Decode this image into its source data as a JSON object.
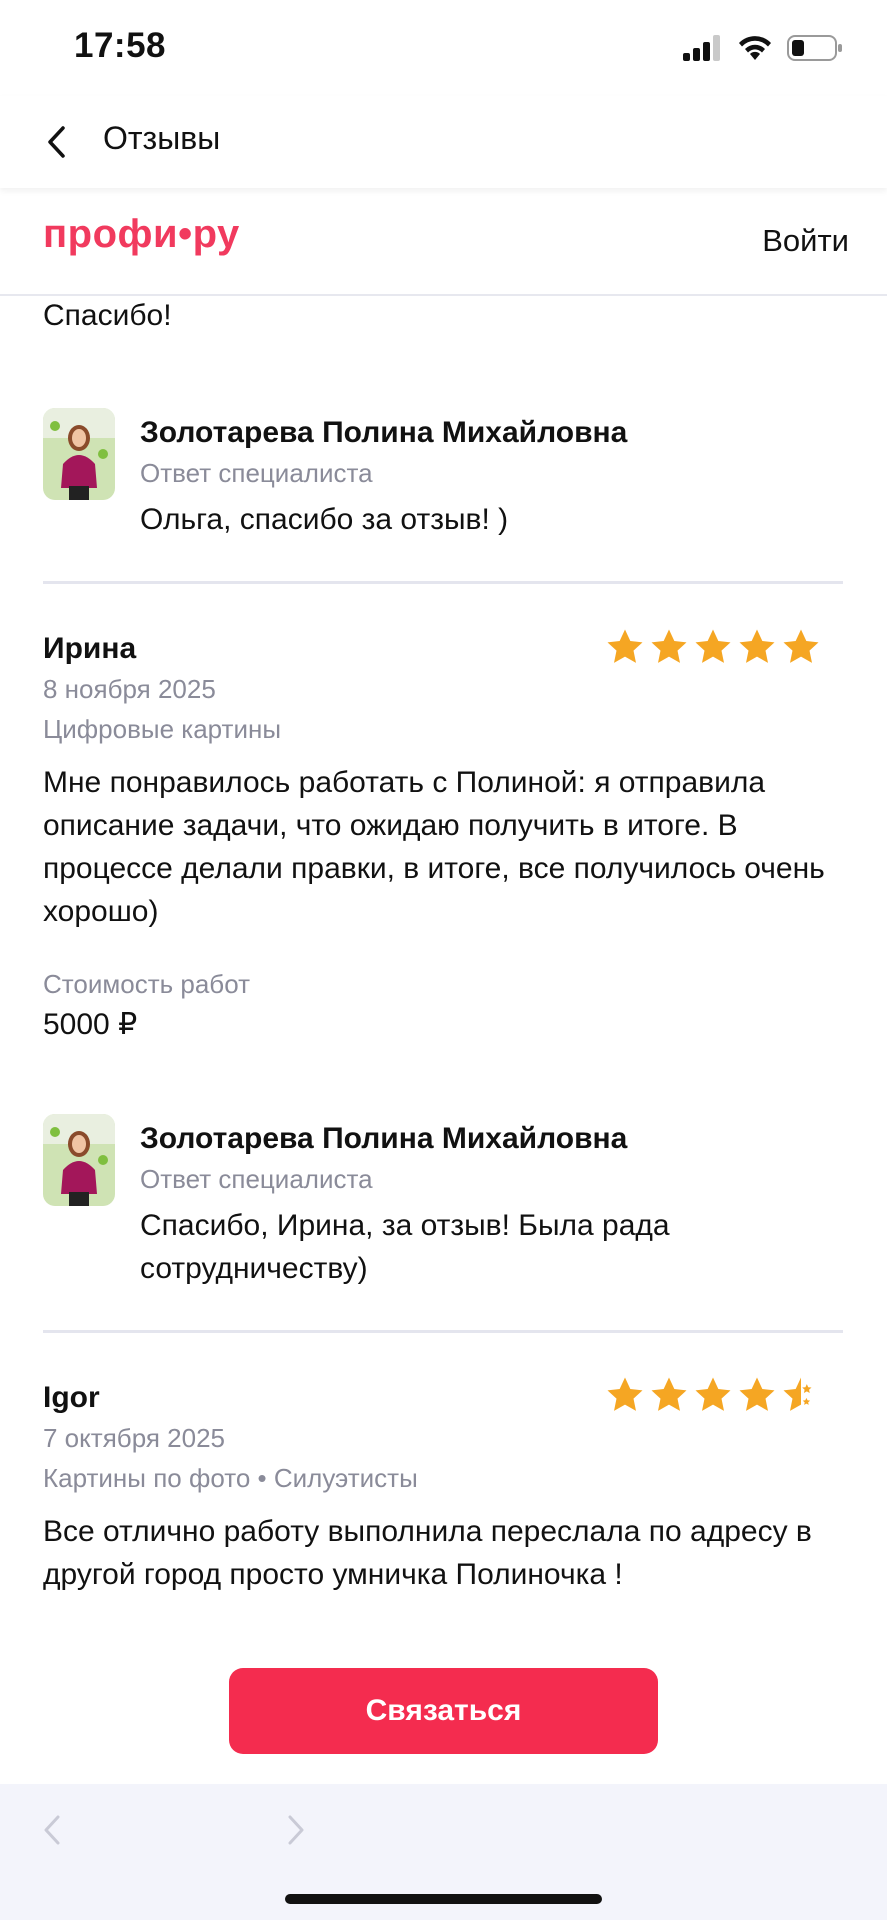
{
  "status_bar": {
    "time": "17:58"
  },
  "nav": {
    "title": "Отзывы"
  },
  "site_header": {
    "logo": "профи•ру",
    "login": "Войти"
  },
  "previous_review": {
    "text_tail": "Спасибо!",
    "reply": {
      "name": "Золотарева Полина Михайловна",
      "role": "Ответ специалиста",
      "text": "Ольга, спасибо за отзыв! )"
    }
  },
  "reviews": [
    {
      "author": "Ирина",
      "date": "8 ноября 2025",
      "category": "Цифровые картины",
      "rating": 5,
      "text": "Мне понравилось работать с Полиной: я отправила описание задачи, что ожидаю получить в итоге. В процессе делали правки, в итоге, все получилось очень хорошо)",
      "price_label": "Стоимость работ",
      "price_value": "5000 ₽",
      "reply": {
        "name": "Золотарева Полина Михайловна",
        "role": "Ответ специалиста",
        "text": "Спасибо, Ирина, за отзыв! Была рада сотрудничеству)"
      }
    },
    {
      "author": "Igor",
      "date": "7 октября 2025",
      "category": "Картины по фото • Силуэтисты",
      "rating": 4.5,
      "text": "Все отлично работу выполнила переслала по адресу в другой город просто умничка Полиночка !"
    }
  ],
  "action": {
    "contact_label": "Связаться"
  },
  "colors": {
    "brand": "#f13a5e",
    "button": "#f42c4f",
    "star": "#f5a623",
    "muted": "#8a8b99"
  }
}
